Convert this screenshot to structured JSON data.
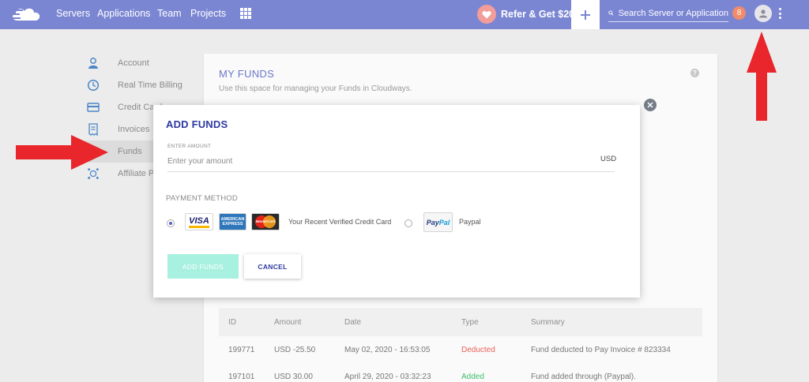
{
  "topbar": {
    "nav": [
      {
        "label": "Servers"
      },
      {
        "label": "Applications"
      },
      {
        "label": "Team"
      },
      {
        "label": "Projects"
      }
    ],
    "refer_label": "Refer & Get $20",
    "search_placeholder": "Search Server or Application",
    "notification_count": "8",
    "brand_color": "#7b86d3"
  },
  "sidebar": {
    "items": [
      {
        "label": "Account",
        "icon": "user-icon"
      },
      {
        "label": "Real Time Billing",
        "icon": "clock-icon"
      },
      {
        "label": "Credit Card",
        "icon": "credit-card-icon"
      },
      {
        "label": "Invoices",
        "icon": "invoice-icon"
      },
      {
        "label": "Funds",
        "icon": "funds-icon",
        "active": true
      },
      {
        "label": "Affiliate Program",
        "icon": "affiliate-icon"
      }
    ]
  },
  "funds": {
    "title": "MY FUNDS",
    "subtitle": "Use this space for managing your Funds in Cloudways.",
    "table": {
      "headers": [
        "ID",
        "Amount",
        "Date",
        "Type",
        "Summary"
      ],
      "rows": [
        {
          "id": "199771",
          "amount": "USD -25.50",
          "date": "May 02, 2020 - 16:53:05",
          "type": "Deducted",
          "summary": "Fund deducted to Pay Invoice # 823334"
        },
        {
          "id": "197101",
          "amount": "USD 30.00",
          "date": "April 29, 2020 - 03:32:23",
          "type": "Added",
          "summary": "Fund added through (Paypal)."
        }
      ]
    }
  },
  "modal": {
    "title": "ADD FUNDS",
    "amount_label": "ENTER AMOUNT",
    "amount_placeholder": "Enter your amount",
    "amount_value": "",
    "currency": "USD",
    "payment_method_label": "PAYMENT METHOD",
    "options": [
      {
        "label": "Your Recent Verified Credit Card",
        "selected": true
      },
      {
        "label": "Paypal",
        "selected": false
      }
    ],
    "card_logos": {
      "visa": "VISA",
      "amex": "AMERICAN EXPRESS",
      "mastercard": "MasterCard",
      "paypal_pay": "Pay",
      "paypal_pal": "Pal"
    },
    "add_button": "ADD FUNDS",
    "cancel_button": "CANCEL",
    "accent": "#2d3aa0"
  },
  "annotations": {
    "arrow_color": "#e8262b"
  }
}
